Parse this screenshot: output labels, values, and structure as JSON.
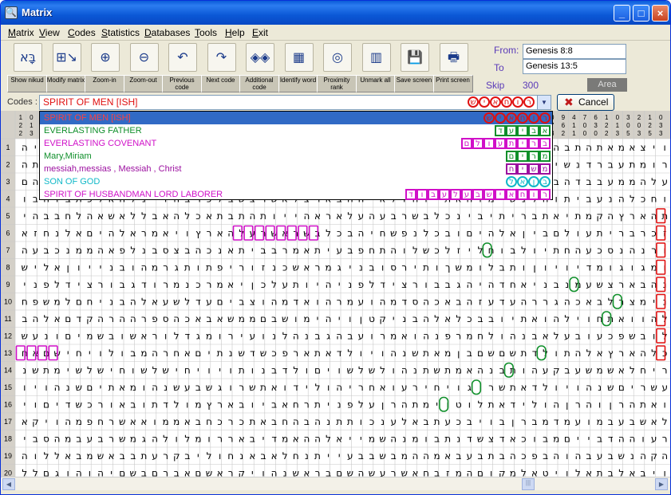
{
  "window": {
    "title": "Matrix",
    "app_icon": "magnifier-icon",
    "min": "_",
    "max": "□",
    "close": "×"
  },
  "menu": [
    "Matrix",
    "View",
    "Codes",
    "Statistics",
    "Databases",
    "Tools",
    "Help",
    "Exit"
  ],
  "toolbar": [
    {
      "name": "show-nikud",
      "label": "Show nikud",
      "glyph": "בָּא",
      "icon": "nikud-icon"
    },
    {
      "name": "modify-matrix",
      "label": "Modify matrix",
      "glyph": "⊞↘",
      "icon": "matrix-resize-icon"
    },
    {
      "name": "zoom-in",
      "label": "Zoom-in",
      "glyph": "⊕",
      "icon": "zoom-in-icon"
    },
    {
      "name": "zoom-out",
      "label": "Zoom-out",
      "glyph": "⊖",
      "icon": "zoom-out-icon"
    },
    {
      "name": "previous-code",
      "label": "Previous code",
      "glyph": "↶",
      "icon": "previous-code-icon"
    },
    {
      "name": "next-code",
      "label": "Next code",
      "glyph": "↷",
      "icon": "next-code-icon"
    },
    {
      "name": "additional-code",
      "label": "Additional code",
      "glyph": "◈◈",
      "icon": "additional-code-icon"
    },
    {
      "name": "identify-word",
      "label": "Identify word",
      "glyph": "▦",
      "icon": "identify-word-icon"
    },
    {
      "name": "proximity-rank",
      "label": "Proximity rank",
      "glyph": "◎",
      "icon": "proximity-rank-icon"
    },
    {
      "name": "unmark-all",
      "label": "Unmark all",
      "glyph": "▥",
      "icon": "unmark-all-icon"
    },
    {
      "name": "save-screen",
      "label": "Save screen",
      "glyph": "💾",
      "icon": "save-screen-icon"
    },
    {
      "name": "print-screen",
      "label": "Print screen",
      "glyph": "🖶",
      "icon": "print-screen-icon"
    }
  ],
  "range": {
    "from_label": "From:",
    "from": "Genesis 8:8",
    "to_label": "To",
    "to": "Genesis 13:5",
    "skip_label": "Skip",
    "skip": "300",
    "area_label": "Area"
  },
  "codes": {
    "label": "Codes :",
    "selected": "SPIRIT OF MEN [ISH]",
    "selected_tiles": "רוחאיש",
    "cancel": "Cancel",
    "cancel_icon": "cancel-x-icon",
    "dropdown_icon": "chevron-down-icon"
  },
  "code_list": [
    {
      "text": "SPIRIT OF MEN [ISH]",
      "color": "#e01010",
      "tiles": "רוחאיש",
      "tile_color": "#e01010"
    },
    {
      "text": "EVERLASTING FATHER",
      "color": "#0f8f2a",
      "tiles": "אביעד",
      "tile_color": "#0f8f2a"
    },
    {
      "text": "EVERLASTING COVENANT",
      "color": "#d010c8",
      "tiles": "בריתעולם",
      "tile_color": "#d010c8"
    },
    {
      "text": "Mary,Miriam",
      "color": "#0f8f2a",
      "tiles": "מרים",
      "tile_color": "#0f8f2a"
    },
    {
      "text": "messiah,messias , Messiah , Christ",
      "color": "#9c10a0",
      "tiles": "משיח",
      "tile_color": "#9c10a0"
    },
    {
      "text": "SON OF GOD",
      "color": "#10b8c8",
      "tiles": "בןאל",
      "tile_color": "#10b8c8"
    },
    {
      "text": "SPIRIT OF HUSBANDMAN LORD LABORER",
      "color": "#d010c8",
      "tiles": "רוחאישבעלעבוד",
      "tile_color": "#d010c8"
    }
  ],
  "col_header_digits": [
    "1",
    "0",
    "3",
    "2",
    "1",
    "0",
    "0",
    "2",
    "3",
    "5",
    "3",
    "5",
    "3",
    "2",
    "1",
    "0",
    "3",
    "5",
    "3",
    "5",
    "3",
    "4",
    "0",
    "9",
    "4",
    "7",
    "6"
  ],
  "row_numbers": [
    "1",
    "2",
    "3",
    "4",
    "5",
    "6",
    "7",
    "8",
    "9",
    "10",
    "11",
    "12",
    "13",
    "14",
    "15",
    "16",
    "17",
    "18",
    "19",
    "20"
  ],
  "matrix_rows": [
    "ויצאמאתהתבהמהעתרהכיתצייאהויפתחנחאמהיוהיימםאבשלמחאאבשלהשנימיהוהיהנמראתתהנבשניפרפ",
    "רומתעברדנשימרמהעאלמוםויובהותכבראתהיונהמעלפניהאדמהויאמרלואלתהיוהיוהודנהאלאלהיכאחנ",
    "עלהממעבבדהבשמיתירפובכלעלפמבדבכליובשויהואבןבתהולוודבבתהרבוכהםתבקוהיללכלבואראבזב",
    "וחכלהנעביתוהלנשימוחאתיוהולאיההבארצלאשרצשבלכרבהוינלהאלכתבוהבולעתובהוביוההובנאחבהר",
    "תהארץהקמתיאתבריתיבינכלבשרבעהעלאראהייותהתבתאכלהאבללאשאהלחבבהיכיוביבוכוהכאלההכל",
    "זכרבריתעולםביןאלהיםובכלנפשחיהבכלבשראשרעלהארץויאמראלהיםאלנחזאתאותהבריתאשרהקמתי",
    "ורנהנסכעהחתיולבוחליזלכשלוהתחפבעיתאמרבביתאנכהבצסבנלפאהממנכבעהתיורגירחםשריננואתה",
    "ומגוגומדיויוןותבלומשךותירסובניגמראשכנזוריפתותגרמהובנייוןאלישהותרשישכתיםודדנים",
    "נהבארצשעמנבניאחדהיהגבבורצידלפניהיותעלכןיאמרכנמרודגבורצידלפניהויהיראשיתממלכתו",
    "נימצרלבאכהגררהעדעזהבאכהסדמהועמרהואדמהוצביםעדלשעאלהבניחםלמשפחתםללשנתםבארצתםבגויה",
    "להוואתחוילהואתיובבכלאלהבניקטןויהימושבםממשאבאכהספרההרהקדםאלהבנישםלמשפחתםללשנתם",
    "לובשפכעובעלאבנהולחמרפנהואמרועבהגבנהלנועירומגדלוראשובשמיםונעשהלנושםפןנפוץעלפני",
    "כלהארץאלהתולדתשםשםבןמאתשנהויולדאתארפכשדשנתיםאחרהמבולויחישםאחריהולידואתארפכשד",
    "ריחלאשמשעבקעהותבנהאמתשתנהולשלשויםולדבנותויויחישלשוחישלשימתשנהויולדאתעברויחישלח",
    "עשריםשנהויולדאתשרוגויחירעואחריהולידואתשרוגשבעשנהומאתיםשנהויולדבניםובנותויחי",
    "ואתהרןוהרןהולידאתלוטוימתהרןעלפניתרחאביובארץמולדתובאורכשדיםויקחאבראםונחורלהםנשים",
    "לאשבעבמועמדמברןבויבכעתבאלענכותתנהבהחבאתכרכחבאממואאשרחפמהויקאבותםעלשתייאממםחנו",
    "רעוההדבייםמבוכאדצשדנתבומנהשמייאלההאמדיבאררומלולהגמשרבעבמהסבירלתוהכבאשלבבאכאבבלר",
    "הקהנשבעבהוהבפכהבתבעבאמההמבשבבעייתנחלאבאנחוליבקרעתבבאשמבאללוהכבתיכהחשאבחשבגממע",
    "ויבאלבתאלויטאלמקוםהמזבחאשרעשהשםבראשנהויקראשםאברםבשםיהוהוגםללוטההלךאתאברםהיהצאן"
  ],
  "highlights": [
    {
      "row": 6,
      "cols": [
        20,
        21,
        22,
        23,
        24,
        25,
        26,
        27
      ],
      "color": "#d010c8"
    },
    {
      "row": 5,
      "col": 59,
      "color": "#e01010"
    },
    {
      "row": 6,
      "col": 59,
      "color": "#e01010"
    },
    {
      "row": 7,
      "col": 59,
      "color": "#e01010"
    },
    {
      "row": 8,
      "col": 59,
      "color": "#e01010"
    },
    {
      "row": 9,
      "col": 59,
      "color": "#e01010"
    },
    {
      "row": 10,
      "col": 59,
      "color": "#e01010"
    },
    {
      "row": 11,
      "col": 59,
      "color": "#e01010"
    },
    {
      "row": 12,
      "col": 59,
      "color": "#e01010"
    },
    {
      "row": 13,
      "col": 59,
      "color": "#e01010"
    },
    {
      "row": 13,
      "cols": [
        0,
        1,
        2,
        3
      ],
      "color": "#d010c8"
    },
    {
      "row": 7,
      "col": 43,
      "color": "#0f8f2a",
      "round": true
    },
    {
      "row": 9,
      "col": 51,
      "color": "#0f8f2a",
      "round": true
    },
    {
      "row": 10,
      "col": 55,
      "color": "#0f8f2a",
      "round": true
    },
    {
      "row": 11,
      "col": 54,
      "color": "#0f8f2a",
      "round": true
    },
    {
      "row": 13,
      "col": 48,
      "color": "#0f8f2a",
      "round": true
    },
    {
      "row": 14,
      "col": 45,
      "color": "#0f8f2a",
      "round": true
    },
    {
      "row": 15,
      "col": 42,
      "color": "#0f8f2a",
      "round": true
    },
    {
      "row": 16,
      "col": 39,
      "color": "#0f8f2a",
      "round": true
    }
  ],
  "colors": {
    "title": "#0a5bd8",
    "grid": "#c8c8c8",
    "header_bg": "#d4d0c8"
  }
}
